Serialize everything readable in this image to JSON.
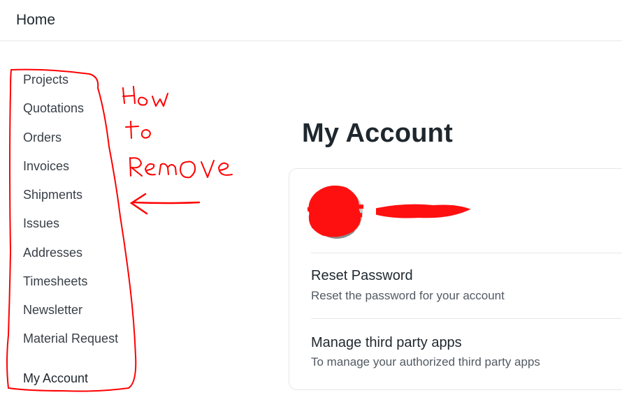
{
  "navbar": {
    "home_label": "Home"
  },
  "sidebar": {
    "items": [
      {
        "label": "Projects"
      },
      {
        "label": "Quotations"
      },
      {
        "label": "Orders"
      },
      {
        "label": "Invoices"
      },
      {
        "label": "Shipments"
      },
      {
        "label": "Issues"
      },
      {
        "label": "Addresses"
      },
      {
        "label": "Timesheets"
      },
      {
        "label": "Newsletter"
      },
      {
        "label": "Material Request"
      },
      {
        "label": "My Account"
      }
    ]
  },
  "main": {
    "title": "My Account",
    "profile": {
      "name": ""
    },
    "rows": [
      {
        "title": "Reset Password",
        "description": "Reset the password for your account"
      },
      {
        "title": "Manage third party apps",
        "description": "To manage your authorized third party apps"
      }
    ]
  },
  "annotation": {
    "lines": [
      "How",
      "to",
      "Remove"
    ],
    "color": "#ff0000"
  }
}
